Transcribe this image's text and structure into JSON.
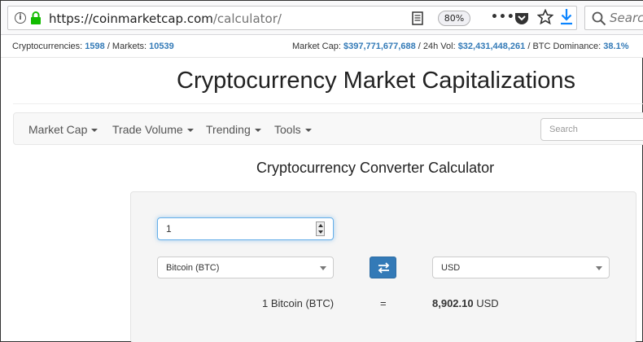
{
  "browser": {
    "url_host": "https://coinmarketcap.com",
    "url_path": "/calculator/",
    "zoom": "80%",
    "search_placeholder": "Search"
  },
  "stats": {
    "cryptocurrencies_label": "Cryptocurrencies:",
    "cryptocurrencies_value": "1598",
    "markets_label": "/ Markets:",
    "markets_value": "10539",
    "market_cap_label": "Market Cap:",
    "market_cap_value": "$397,771,677,688",
    "vol_label": "/ 24h Vol:",
    "vol_value": "$32,431,448,261",
    "dominance_label": "/ BTC Dominance:",
    "dominance_value": "38.1%"
  },
  "site_title": "Cryptocurrency Market Capitalizations",
  "navbar": {
    "items": [
      {
        "label": "Market Cap"
      },
      {
        "label": "Trade Volume"
      },
      {
        "label": "Trending"
      },
      {
        "label": "Tools"
      }
    ],
    "search_placeholder": "Search"
  },
  "calculator": {
    "heading": "Cryptocurrency Converter Calculator",
    "amount": "1",
    "from_currency": "Bitcoin (BTC)",
    "to_currency": "USD",
    "result_left": "1 Bitcoin (BTC)",
    "equals": "=",
    "result_value": "8,902.10",
    "result_unit": "USD"
  },
  "colors": {
    "link_blue": "#337ab7",
    "lock_green": "#12bc00",
    "download_blue": "#0a84ff"
  }
}
